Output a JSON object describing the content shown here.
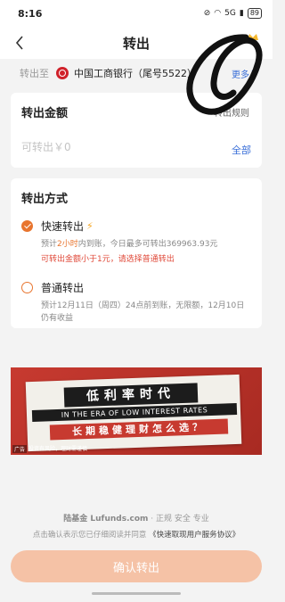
{
  "status": {
    "time": "8:16",
    "signal": "5G",
    "battery": "89"
  },
  "nav": {
    "title": "转出"
  },
  "destination": {
    "label": "转出至",
    "bank": "中国工商银行（尾号5522）",
    "more": "更多"
  },
  "amount": {
    "title": "转出金额",
    "extra": "转出规则",
    "placeholder": "可转出￥0",
    "all": "全部"
  },
  "method": {
    "title": "转出方式",
    "fast": {
      "name": "快速转出",
      "desc_pre": "预计",
      "desc_hl": "2小时",
      "desc_post": "内到账，今日最多可转出369963.93元",
      "warning": "可转出金额小于1元，请选择普通转出"
    },
    "normal": {
      "name": "普通转出",
      "desc": "预计12月11日（周四）24点前到账，无限额，12月10日仍有收益"
    }
  },
  "banner": {
    "title": "低利率时代",
    "english": "IN THE ERA OF LOW INTEREST RATES",
    "subtitle": "长期稳健理财怎么选？",
    "ad_tag": "广告",
    "ad_note": "投资有风险，理财需谨慎"
  },
  "footer": {
    "brand": "陆基金 Lufunds.com",
    "tagline": " · 正规 安全 专业",
    "agree_pre": "点击确认表示您已仔细阅读并同意",
    "agree_link": "《快速取现用户服务协议》"
  },
  "confirm": {
    "label": "确认转出"
  },
  "colors": {
    "accent": "#e8752f",
    "link": "#3a6fd8",
    "button": "#f5c2a6",
    "warning": "#e04a3a"
  }
}
